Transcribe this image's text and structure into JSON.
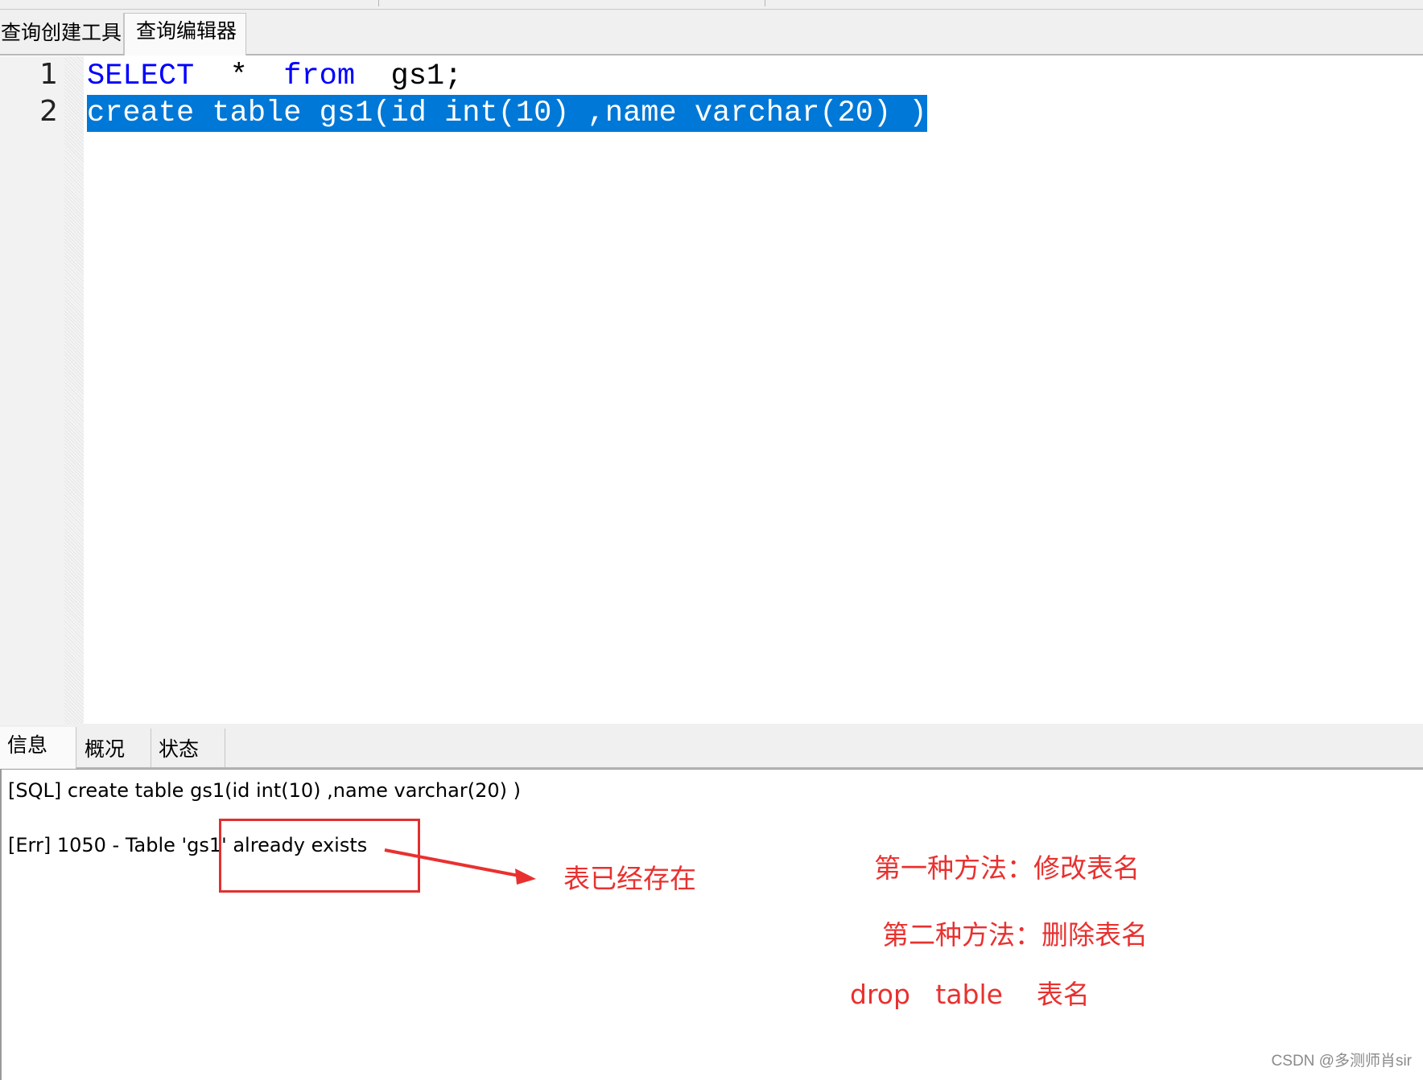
{
  "editor_tabs": [
    "查询创建工具",
    "查询编辑器"
  ],
  "editor": {
    "line_numbers": [
      "1",
      "2"
    ],
    "line1": {
      "kw1": "SELECT",
      "mid": "  *  ",
      "kw2": "from",
      "rest": "  gs1;"
    },
    "line2": "create table gs1(id int(10) ,name varchar(20) )"
  },
  "result_tabs": [
    "信息",
    "概况",
    "状态"
  ],
  "messages": {
    "sql": "[SQL] create table gs1(id int(10) ,name varchar(20) )",
    "err": "[Err] 1050 - Table 'gs1' already exists"
  },
  "annotations": {
    "exists_note": "表已经存在",
    "method1": "第一种方法：修改表名",
    "method2": "第二种方法：删除表名",
    "drop_cmd": "drop   table    表名"
  },
  "watermark": "CSDN @多测师肖sir",
  "colors": {
    "keyword": "#0000ff",
    "selection": "#0078d7",
    "annotation": "#e8312f"
  }
}
